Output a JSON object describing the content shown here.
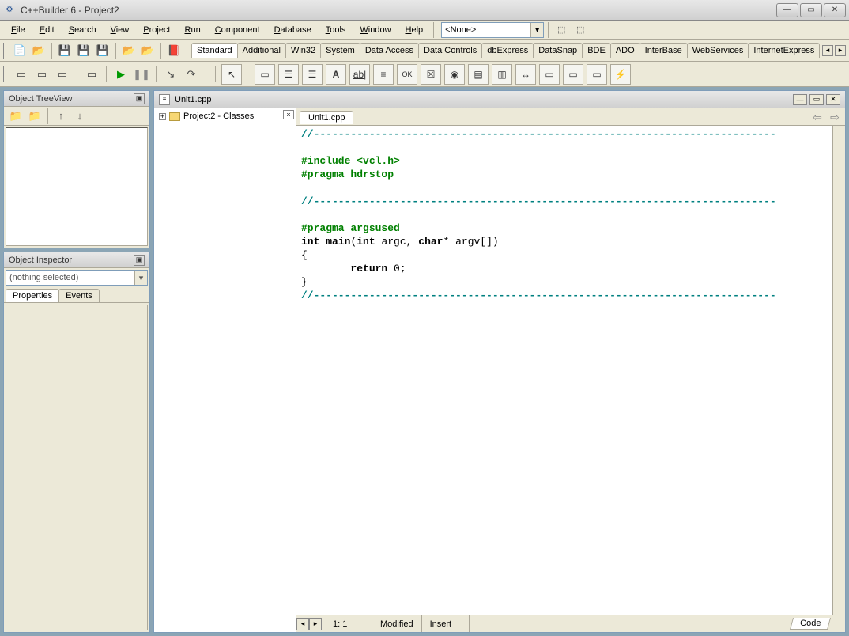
{
  "window": {
    "title": "C++Builder 6 - Project2"
  },
  "menu": {
    "items": [
      "File",
      "Edit",
      "Search",
      "View",
      "Project",
      "Run",
      "Component",
      "Database",
      "Tools",
      "Window",
      "Help"
    ],
    "combo_value": "<None>"
  },
  "palette_tabs": [
    "Standard",
    "Additional",
    "Win32",
    "System",
    "Data Access",
    "Data Controls",
    "dbExpress",
    "DataSnap",
    "BDE",
    "ADO",
    "InterBase",
    "WebServices",
    "InternetExpress"
  ],
  "palette_active": 0,
  "left_panels": {
    "treeview": {
      "title": "Object TreeView"
    },
    "inspector": {
      "title": "Object Inspector",
      "combo": "(nothing selected)",
      "tabs": [
        "Properties",
        "Events"
      ],
      "active_tab": 0
    }
  },
  "project_tree": {
    "root": "Project2 - Classes"
  },
  "editor": {
    "title": "Unit1.cpp",
    "tab": "Unit1.cpp",
    "code_lines": [
      {
        "t": "comment",
        "s": "//---------------------------------------------------------------------------"
      },
      {
        "t": "blank",
        "s": ""
      },
      {
        "t": "pre",
        "s": "#include <vcl.h>"
      },
      {
        "t": "pre",
        "s": "#pragma hdrstop"
      },
      {
        "t": "blank",
        "s": ""
      },
      {
        "t": "comment",
        "s": "//---------------------------------------------------------------------------"
      },
      {
        "t": "blank",
        "s": ""
      },
      {
        "t": "pre",
        "s": "#pragma argsused"
      },
      {
        "t": "code",
        "s": "int main(int argc, char* argv[])"
      },
      {
        "t": "code",
        "s": "{"
      },
      {
        "t": "code",
        "s": "        return 0;"
      },
      {
        "t": "code",
        "s": "}"
      },
      {
        "t": "comment",
        "s": "//---------------------------------------------------------------------------"
      }
    ],
    "status": {
      "pos": "1: 1",
      "modified": "Modified",
      "mode": "Insert",
      "view_tab": "Code"
    }
  }
}
